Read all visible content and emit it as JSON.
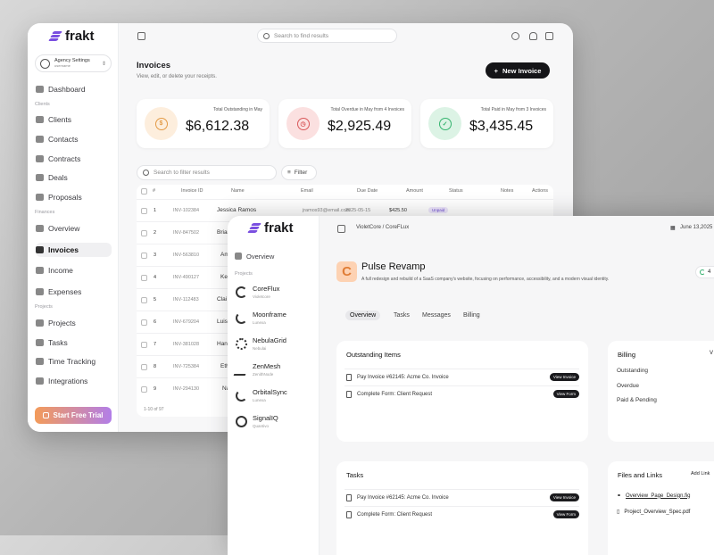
{
  "win1": {
    "brand": "frakt",
    "agency": {
      "title": "Agency Settings",
      "sub": "username"
    },
    "nav": {
      "dashboard": "Dashboard",
      "sec_clients": "Clients",
      "clients": "Clients",
      "contacts": "Contacts",
      "contracts": "Contracts",
      "deals": "Deals",
      "proposals": "Proposals",
      "sec_finances": "Finances",
      "overview": "Overview",
      "invoices": "Invoices",
      "income": "Income",
      "expenses": "Expenses",
      "sec_projects": "Projects",
      "projects": "Projects",
      "tasks": "Tasks",
      "time": "Time Tracking",
      "integrations": "Integrations"
    },
    "trial": "Start Free Trial",
    "search_placeholder": "Search to find results",
    "page_title": "Invoices",
    "page_sub": "View, edit, or delete your receipts.",
    "new_invoice": "New Invoice",
    "cards": [
      {
        "label": "Total Outstanding in May",
        "value": "$6,612.38",
        "color": "#f0a24a",
        "icon": "$"
      },
      {
        "label": "Total Overdue in May from 4 Invoices",
        "value": "$2,925.49",
        "color": "#e0585a",
        "icon": "clock"
      },
      {
        "label": "Total Paid in May from 3 Invoices",
        "value": "$3,435.45",
        "color": "#34b36e",
        "icon": "check"
      }
    ],
    "filter_placeholder": "Search to filter results",
    "filter": "Filter",
    "headers": {
      "num": "#",
      "id": "Invoice ID",
      "name": "Name",
      "email": "Email",
      "due": "Due Date",
      "amount": "Amount",
      "status": "Status",
      "notes": "Notes",
      "actions": "Actions"
    },
    "rows": [
      {
        "n": "1",
        "id": "INV-102384",
        "name": "Jessica Ramos",
        "email": "jramos93@email.com",
        "due": "2025-05-15",
        "amount": "$425.50",
        "status": "Unpaid"
      },
      {
        "n": "2",
        "id": "INV-847502",
        "name": "Brian"
      },
      {
        "n": "3",
        "id": "INV-563810",
        "name": "Am"
      },
      {
        "n": "4",
        "id": "INV-490127",
        "name": "Ke"
      },
      {
        "n": "5",
        "id": "INV-112483",
        "name": "Clai"
      },
      {
        "n": "6",
        "id": "INV-679204",
        "name": "Luis"
      },
      {
        "n": "7",
        "id": "INV-381028",
        "name": "Hann"
      },
      {
        "n": "8",
        "id": "INV-725384",
        "name": "Eth"
      },
      {
        "n": "9",
        "id": "INV-294130",
        "name": "Na"
      }
    ],
    "pagination": "1-10 of 97"
  },
  "win2": {
    "brand": "frakt",
    "overview": "Overview",
    "sec_projects": "Projects",
    "projects": [
      {
        "name": "CoreFlux",
        "sub": "Violetcore"
      },
      {
        "name": "Moonframe",
        "sub": "Lunexa"
      },
      {
        "name": "NebulaGrid",
        "sub": "Nebulai"
      },
      {
        "name": "ZenMesh",
        "sub": "ZenithNode"
      },
      {
        "name": "OrbitalSync",
        "sub": "Lunexa"
      },
      {
        "name": "SignalIQ",
        "sub": "Quantivo"
      }
    ],
    "breadcrumb": "VioletCore / CoreFLux",
    "date": "June 13,2025",
    "project_icon": "C",
    "project_title": "Pulse Revamp",
    "project_desc": "A full redesign and rebuild of a SaaS company's website, focusing on performance, accessibility, and a modern visual identity.",
    "status": "4",
    "tabs": [
      "Overview",
      "Tasks",
      "Messages",
      "Billing"
    ],
    "outstanding": {
      "title": "Outstanding Items",
      "items": [
        {
          "text": "Pay Invoice #62145: Acme Co. Invoice",
          "btn": "View Invoice"
        },
        {
          "text": "Complete Form: Client Request",
          "btn": "View Form"
        }
      ]
    },
    "billing": {
      "title": "Billing",
      "v": "V",
      "rows": [
        "Outstanding",
        "Overdue",
        "Paid & Pending"
      ]
    },
    "tasks": {
      "title": "Tasks",
      "items": [
        {
          "text": "Pay Invoice #62145: Acme Co. Invoice",
          "btn": "View Invoice"
        },
        {
          "text": "Complete Form: Client Request",
          "btn": "View Form"
        }
      ]
    },
    "files": {
      "title": "Files and Links",
      "add": "Add Link",
      "items": [
        "Overview_Page_Design.fig",
        "Project_Overview_Spec.pdf"
      ]
    }
  }
}
